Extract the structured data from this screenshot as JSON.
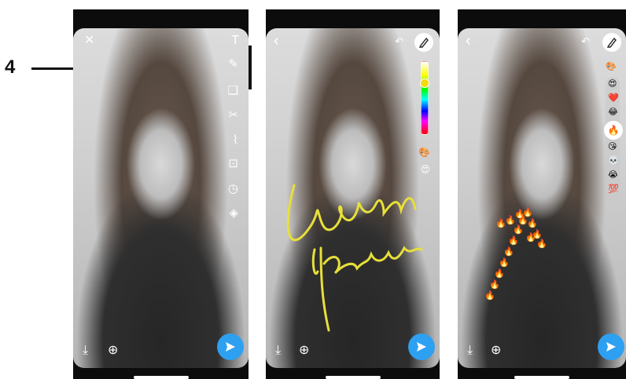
{
  "callout": {
    "number": "4"
  },
  "panels": [
    {
      "name": "tools-panel",
      "toolbar": [
        "✕",
        "T",
        "✎",
        "❏",
        "✂",
        "⌇",
        "⊡",
        "◷",
        "◈"
      ],
      "bottom_icons": [
        "⤓",
        "⊕"
      ]
    },
    {
      "name": "draw-panel",
      "top_icons": [
        "‹",
        "↶"
      ],
      "handwriting_line1": "lorem",
      "handwriting_line2": "ipsum",
      "ink_color": "#e8df3a",
      "bottom_icons": [
        "⤓",
        "⊕"
      ]
    },
    {
      "name": "emoji-draw-panel",
      "top_icons": [
        "‹",
        "↶"
      ],
      "selected_emoji": "🔥",
      "emoji_options": [
        "😍",
        "❤️",
        "😂",
        "🔥",
        "😘",
        "💀",
        "😭",
        "💯"
      ],
      "bottom_icons": [
        "⤓",
        "⊕"
      ]
    }
  ],
  "colors": {
    "accent_send": "#2ea0f2",
    "background": "#0c0c0c"
  }
}
